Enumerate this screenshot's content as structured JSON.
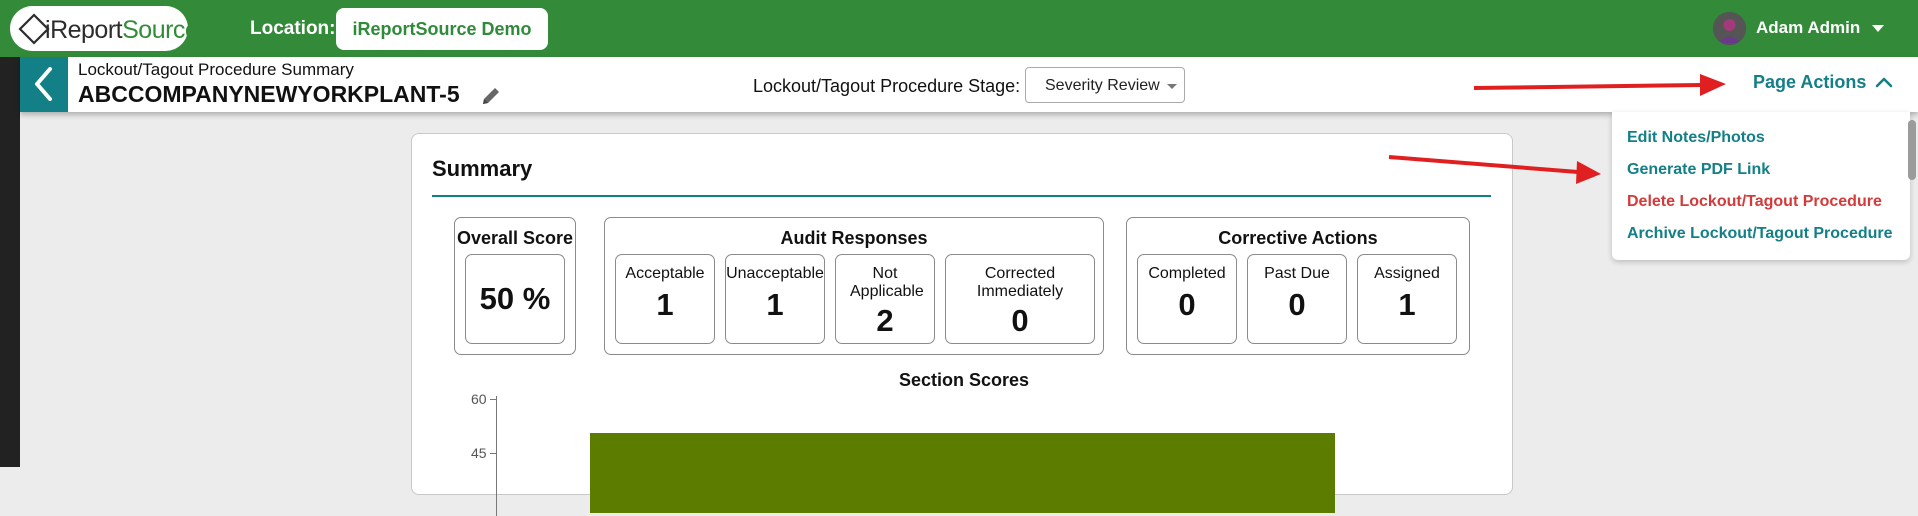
{
  "topbar": {
    "logo": {
      "prefix": "i",
      "brand_a": "Report",
      "brand_b": "Source"
    },
    "location_label": "Location:",
    "location_value": "iReportSource Demo",
    "user_name": "Adam Admin"
  },
  "header": {
    "subtitle": "Lockout/Tagout Procedure Summary",
    "title": "ABCCOMPANYNEWYORKPLANT-5",
    "stage_label": "Lockout/Tagout Procedure Stage:",
    "stage_value": "Severity Review",
    "page_actions": "Page Actions"
  },
  "page_actions_menu": {
    "items": [
      {
        "label": "Edit Notes/Photos",
        "danger": false
      },
      {
        "label": "Generate PDF Link",
        "danger": false
      },
      {
        "label": "Delete Lockout/Tagout Procedure",
        "danger": true
      },
      {
        "label": "Archive Lockout/Tagout Procedure",
        "danger": false
      }
    ]
  },
  "summary": {
    "title": "Summary",
    "overall": {
      "title": "Overall Score",
      "value": "50 %"
    },
    "audit": {
      "title": "Audit Responses",
      "items": [
        {
          "label": "Acceptable",
          "value": "1"
        },
        {
          "label": "Unacceptable",
          "value": "1"
        },
        {
          "label": "Not Applicable",
          "value": "2"
        },
        {
          "label": "Corrected Immediately",
          "value": "0"
        }
      ]
    },
    "corrective": {
      "title": "Corrective Actions",
      "items": [
        {
          "label": "Completed",
          "value": "0"
        },
        {
          "label": "Past Due",
          "value": "0"
        },
        {
          "label": "Assigned",
          "value": "1"
        }
      ]
    },
    "section_scores": {
      "title": "Section Scores",
      "y_ticks": [
        "60",
        "45"
      ],
      "bar_value": 50
    }
  },
  "colors": {
    "topbar": "#338b39",
    "accent": "#137f86",
    "danger": "#d43a3a",
    "bar": "#5c7c00",
    "annotation_arrow": "#e02020"
  }
}
